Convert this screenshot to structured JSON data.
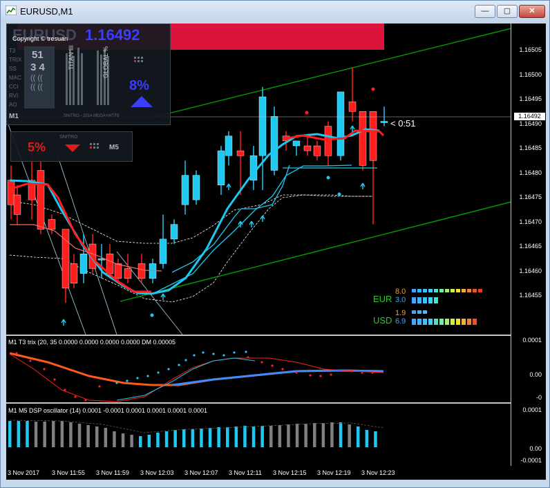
{
  "window": {
    "title": "EURUSD,M1",
    "minimize": "—",
    "maximize": "▢",
    "close": "✕"
  },
  "main": {
    "symbol": "EURUSD",
    "price": "1.16492",
    "copyright": "Copyright © tresuan",
    "panel_nums": [
      "51",
      "3 4"
    ],
    "panel_labels": [
      "T3",
      "TRIX",
      "SS",
      "MAC",
      "CCI",
      "RVI",
      "AO"
    ],
    "panel_vlabels": [
      "TITAN III",
      "GLOBAL %"
    ],
    "pct_up": "8%",
    "pct_down": "5%",
    "tf_left": "M1",
    "tf_right": "M5",
    "footer": "SNITRO - 2014 MEGA+WTF8",
    "snitro_label": "SNITRO",
    "countdown": "< 0:51",
    "currencies": [
      {
        "name": "EUR",
        "values": [
          "8.0",
          "3.0"
        ]
      },
      {
        "name": "USD",
        "values": [
          "1.9",
          "6.9"
        ]
      }
    ],
    "price_labels": [
      "1.16505",
      "1.16500",
      "1.16495",
      "1.16490",
      "1.16485",
      "1.16480",
      "1.16475",
      "1.16470",
      "1.16465",
      "1.16460",
      "1.16455"
    ],
    "current_label": "1.16492"
  },
  "indicator1": {
    "title": "M1 T3 trix (20, 35 0.0000 0.0000 0.0000 0.0000  DM 0.00005",
    "scale": [
      "0.0001",
      "0.00",
      "-0"
    ]
  },
  "indicator2": {
    "title": "M1 M5 DSP oscillator (14) 0.0001 -0.0001 0.0001 0.0001 0.0001 0.0001",
    "scale": [
      "0.0001",
      "0.00",
      "-0.0001"
    ]
  },
  "timeaxis": [
    "3 Nov 2017",
    "3 Nov 11:55",
    "3 Nov 11:59",
    "3 Nov 12:03",
    "3 Nov 12:07",
    "3 Nov 12:11",
    "3 Nov 12:15",
    "3 Nov 12:19",
    "3 Nov 12:23"
  ],
  "colors": {
    "bull": "#1ec8f0",
    "bear": "#ff1e1e",
    "channel": "#00a000",
    "accent": "#3d3dff",
    "banner": "#dc143c"
  }
}
